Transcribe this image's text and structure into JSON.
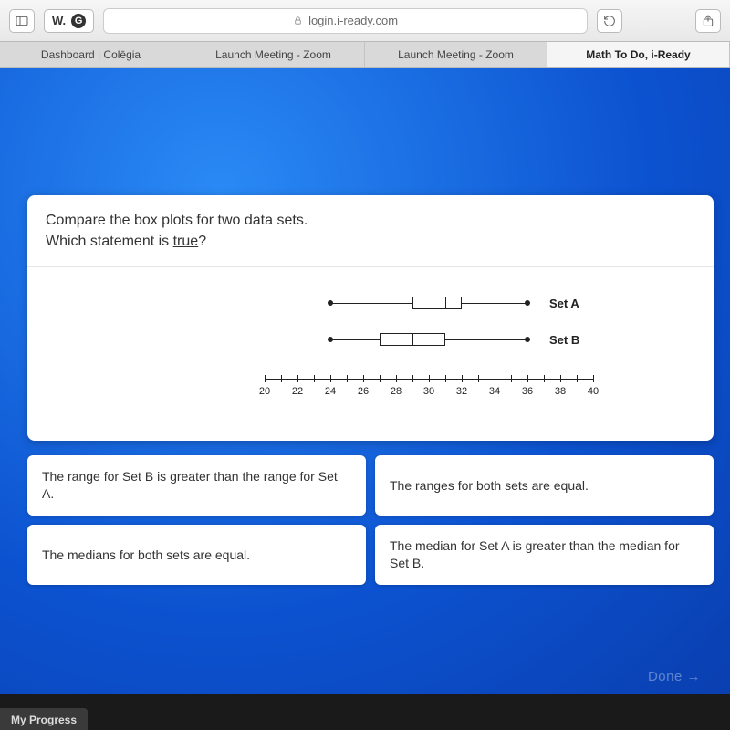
{
  "toolbar": {
    "site_pill": "W.",
    "url": "login.i-ready.com"
  },
  "tabs": [
    {
      "label": "Dashboard | Colēgia",
      "active": false
    },
    {
      "label": "Launch Meeting - Zoom",
      "active": false
    },
    {
      "label": "Launch Meeting - Zoom",
      "active": false
    },
    {
      "label": "Math To Do, i-Ready",
      "active": true
    }
  ],
  "question": {
    "line1": "Compare the box plots for two data sets.",
    "line2_pre": "Which statement is ",
    "line2_u": "true",
    "line2_post": "?"
  },
  "axis": {
    "min": 20,
    "max": 40,
    "ticks": [
      20,
      21,
      22,
      23,
      24,
      25,
      26,
      27,
      28,
      29,
      30,
      31,
      32,
      33,
      34,
      35,
      36,
      37,
      38,
      39,
      40
    ],
    "labels": [
      20,
      22,
      24,
      26,
      28,
      30,
      32,
      34,
      36,
      38,
      40
    ]
  },
  "chart_data": {
    "type": "boxplot",
    "title": "",
    "xlabel": "",
    "ylabel": "",
    "xlim": [
      20,
      40
    ],
    "series": [
      {
        "name": "Set A",
        "min": 24,
        "q1": 29,
        "median": 31,
        "q3": 32,
        "max": 36
      },
      {
        "name": "Set B",
        "min": 24,
        "q1": 27,
        "median": 29,
        "q3": 31,
        "max": 36
      }
    ]
  },
  "answers": [
    "The range for Set B is greater than the range for Set A.",
    "The ranges for both sets are equal.",
    "The medians for both sets are equal.",
    "The median for Set A is greater than the median for Set B."
  ],
  "done_label": "Done →",
  "progress_label": "My Progress"
}
